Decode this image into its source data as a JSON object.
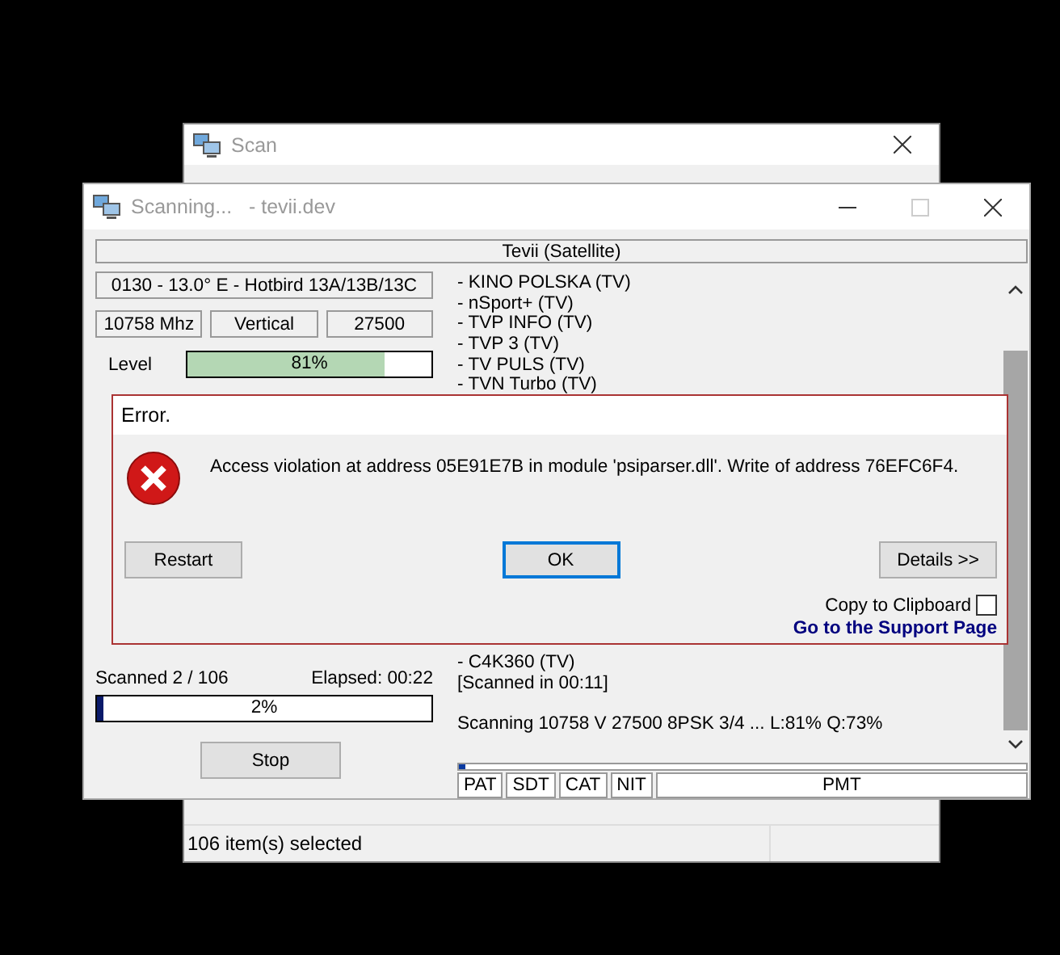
{
  "background_window": {
    "title": "Scan",
    "status_bar": "106 item(s) selected"
  },
  "scan_window": {
    "title": "Scanning...   - tevii.dev",
    "device": "Tevii (Satellite)",
    "satellite": "0130 - 13.0° E - Hotbird 13A/13B/13C",
    "frequency": "10758 Mhz",
    "polarization": "Vertical",
    "symbol_rate": "27500",
    "signal": {
      "label": "Level",
      "level": 0.81,
      "reading": "81%"
    },
    "scanned": "Scanned 2 / 106",
    "elapsed": "Elapsed: 00:22",
    "progress": {
      "level": 0.02,
      "reading": "2%"
    },
    "stop_button": "Stop",
    "channel_log_top": [
      "- KINO POLSKA (TV)",
      "- nSport+ (TV)",
      "- TVP INFO (TV)",
      "- TVP 3 (TV)",
      "- TV PULS (TV)",
      "- TVN Turbo (TV)"
    ],
    "channel_log_bottom": [
      "- C4K360 (TV)",
      "[Scanned in 00:11]",
      "Scanning 10758 V 27500 8PSK 3/4 ... L:81% Q:73%"
    ],
    "table_progress": {
      "level": 0.01
    },
    "tables": [
      "PAT",
      "SDT",
      "CAT",
      "NIT",
      "PMT"
    ]
  },
  "error_dialog": {
    "title": "Error.",
    "message": "Access violation at address 05E91E7B in module 'psiparser.dll'. Write of address 76EFC6F4.",
    "buttons": [
      {
        "label": "Restart",
        "focused": false
      },
      {
        "label": "OK",
        "focused": true
      },
      {
        "label": "Details >>",
        "focused": false
      }
    ],
    "copy_checkbox": {
      "label": "Copy to Clipboard",
      "checked": false
    },
    "link": "Go to the Support Page"
  }
}
